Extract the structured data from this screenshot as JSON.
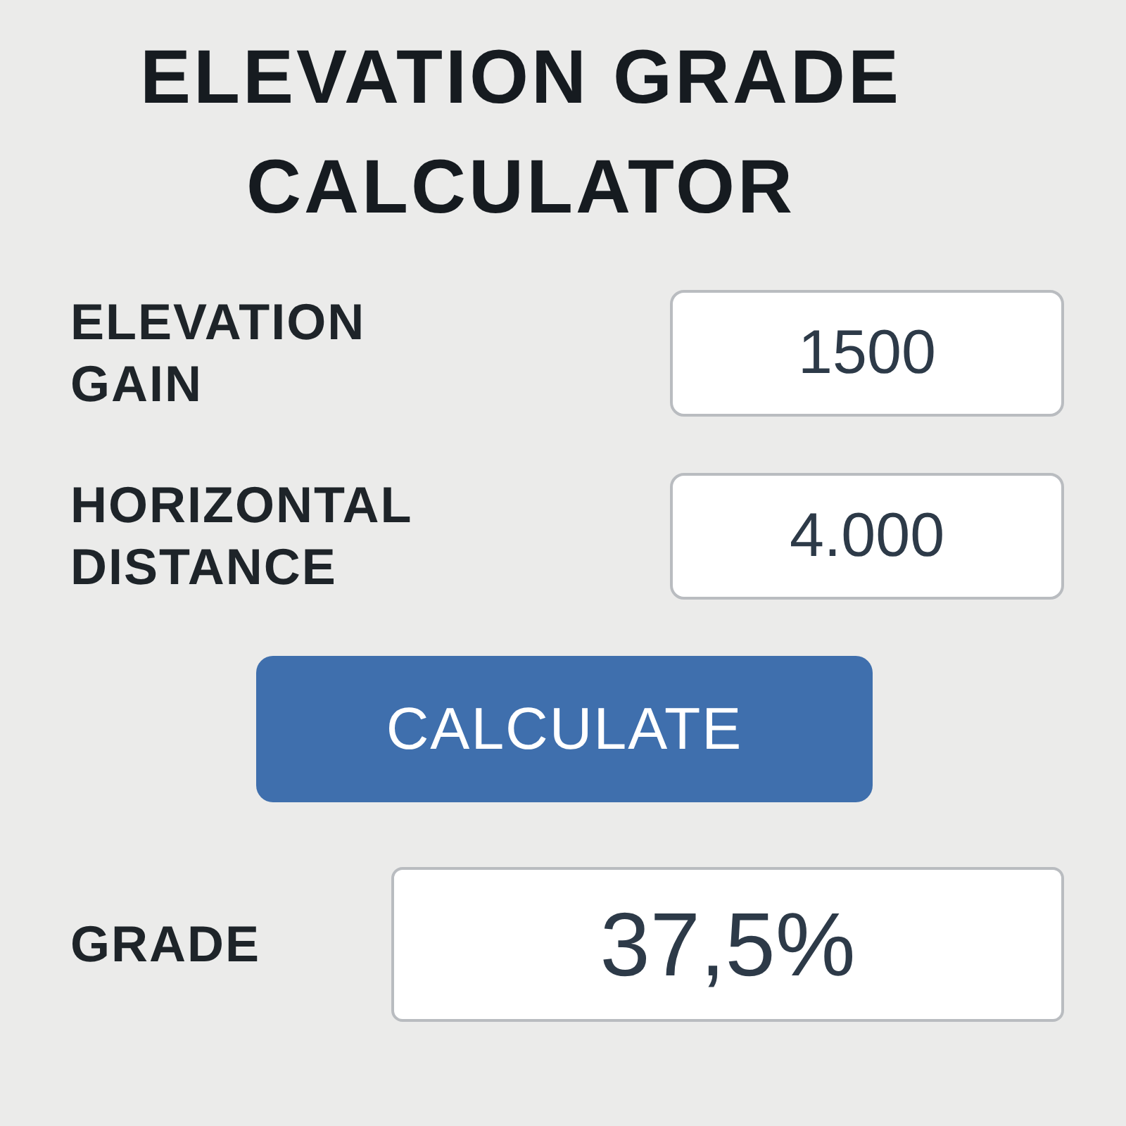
{
  "title": "ELEVATION GRADE CALCULATOR",
  "fields": [
    {
      "label": "ELEVATION GAIN",
      "value": "1500"
    },
    {
      "label": "HORIZONTAL DISTANCE",
      "value": "4.000"
    }
  ],
  "button": "CALCULATE",
  "result": {
    "label": "GRADE",
    "value": "37,5%"
  }
}
